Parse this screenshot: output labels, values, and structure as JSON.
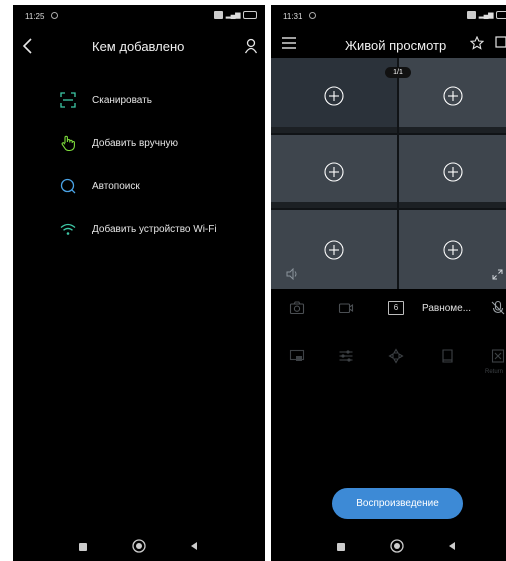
{
  "left": {
    "status": {
      "time": "11:25"
    },
    "header": {
      "title": "Кем добавлено"
    },
    "menu": [
      {
        "label": "Сканировать",
        "icon": "scan-icon"
      },
      {
        "label": "Добавить вручную",
        "icon": "hand-pointer-icon"
      },
      {
        "label": "Автопоиск",
        "icon": "search-icon"
      },
      {
        "label": "Добавить устройство Wi-Fi",
        "icon": "wifi-icon"
      }
    ]
  },
  "right": {
    "status": {
      "time": "11:31"
    },
    "header": {
      "title": "Живой просмотр"
    },
    "page_indicator": "1/1",
    "channel_count": "6",
    "layout_label": "Равноме...",
    "return_label": "Return",
    "play_button": "Воспроизведение"
  },
  "colors": {
    "background": "#000000",
    "cell": "#3e454d",
    "accent_green": "#3ec9a7",
    "accent_blue": "#3d8ad6"
  }
}
